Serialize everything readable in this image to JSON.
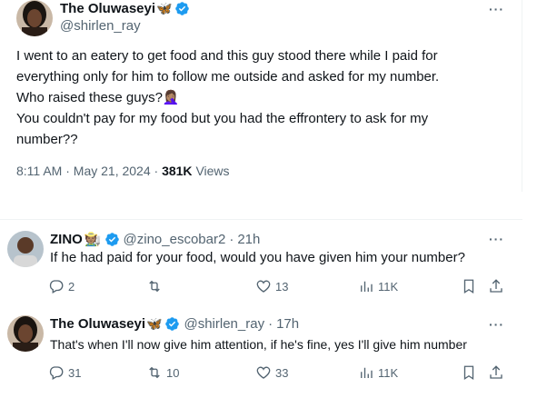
{
  "main_tweet": {
    "author_name": "The Oluwaseyi",
    "name_emoji": "🦋",
    "author_handle": "@shirlen_ray",
    "lines": [
      "I went to an eatery to get food and this guy stood there while I paid for",
      "everything only for him to follow me outside and asked for my number.",
      "Who raised these guys?",
      "You couldn't pay for my food but you had the effrontery to ask for my",
      "number??"
    ],
    "line3_emoji": "🤦🏽‍♀️",
    "time": "8:11 AM",
    "date": "May 21, 2024",
    "views_count": "381K",
    "views_label": "Views",
    "more_label": "···"
  },
  "replies": [
    {
      "author_name": "ZINO",
      "name_emoji": "🧑🏽‍🌾",
      "author_handle": "@zino_escobar2",
      "age": "21h",
      "text": "If he had paid for your food, would you have given him your number?",
      "replies": "2",
      "reposts": "",
      "likes": "13",
      "views": "11K",
      "more_label": "···"
    },
    {
      "author_name": "The Oluwaseyi",
      "name_emoji": "🦋",
      "author_handle": "@shirlen_ray",
      "age": "17h",
      "text": "That's when I'll now give him attention, if he's fine, yes I'll give him number",
      "replies": "31",
      "reposts": "10",
      "likes": "33",
      "views": "11K",
      "more_label": "···"
    }
  ],
  "separator": "·",
  "colors": {
    "verified": "#1d9bf0",
    "muted": "#536471",
    "text": "#0f1419",
    "border": "#eff3f4"
  }
}
